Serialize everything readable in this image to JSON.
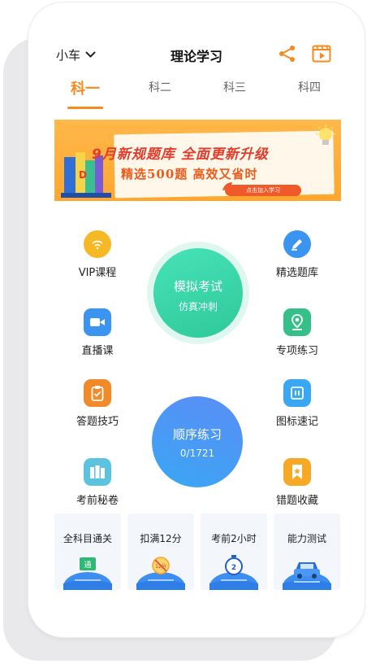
{
  "header": {
    "car_type": "小车",
    "title": "理论学习"
  },
  "tabs": [
    "科一",
    "科二",
    "科三",
    "科四"
  ],
  "banner": {
    "headline": "9月新规题库  全面更新升级",
    "subline": "精选500题  高效又省时",
    "cta": "点击加入学习",
    "book_letter": "D"
  },
  "menu": {
    "left": [
      "VIP课程",
      "直播课",
      "答题技巧",
      "考前秘卷"
    ],
    "right": [
      "精选题库",
      "专项练习",
      "图标速记",
      "错题收藏"
    ]
  },
  "mock_exam": {
    "title": "模拟考试",
    "subtitle": "仿真冲刺"
  },
  "sequential": {
    "title": "顺序练习",
    "progress": "0/1721",
    "done": 0,
    "total": 1721
  },
  "cards": [
    {
      "label": "全科目通关",
      "badge": "通"
    },
    {
      "label": "扣满12分",
      "badge": "12分"
    },
    {
      "label": "考前2小时",
      "badge": "2"
    },
    {
      "label": "能力测试",
      "badge": ""
    }
  ],
  "colors": {
    "accent": "#f58a1f",
    "mock_green": "#2fc99a",
    "sequential_blue": "#4a97f5",
    "icon_blue": "#3a94f0",
    "icon_green": "#35c08a",
    "icon_orange": "#f28a2a",
    "icon_yellow": "#f7b825",
    "icon_teal": "#5bc3e0"
  }
}
